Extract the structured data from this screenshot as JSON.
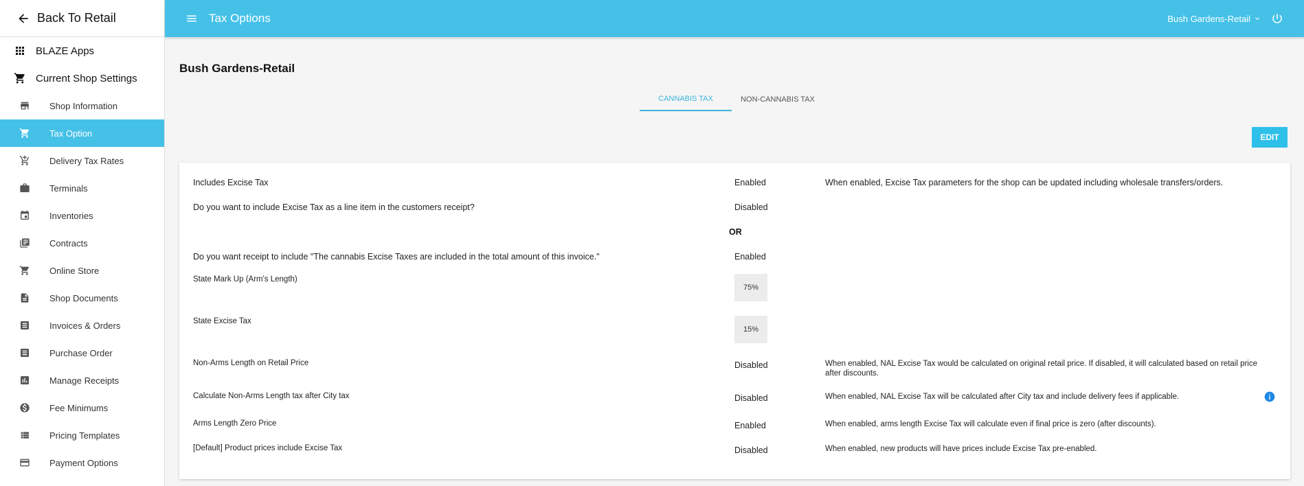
{
  "sidebar": {
    "back_label": "Back To Retail",
    "sections": [
      {
        "label": "BLAZE Apps",
        "icon": "apps-grid-icon"
      },
      {
        "label": "Current Shop Settings",
        "icon": "cart-icon"
      }
    ],
    "items": [
      {
        "label": "Shop Information",
        "icon": "store-icon",
        "active": false
      },
      {
        "label": "Tax Option",
        "icon": "cart-icon",
        "active": true
      },
      {
        "label": "Delivery Tax Rates",
        "icon": "cart-plus-icon",
        "active": false
      },
      {
        "label": "Terminals",
        "icon": "briefcase-icon",
        "active": false
      },
      {
        "label": "Inventories",
        "icon": "calendar-icon",
        "active": false
      },
      {
        "label": "Contracts",
        "icon": "library-icon",
        "active": false
      },
      {
        "label": "Online Store",
        "icon": "cart-icon",
        "active": false
      },
      {
        "label": "Shop Documents",
        "icon": "document-icon",
        "active": false
      },
      {
        "label": "Invoices & Orders",
        "icon": "list-icon",
        "active": false
      },
      {
        "label": "Purchase Order",
        "icon": "list-icon",
        "active": false
      },
      {
        "label": "Manage Receipts",
        "icon": "bar-chart-icon",
        "active": false
      },
      {
        "label": "Fee Minimums",
        "icon": "dollar-icon",
        "active": false
      },
      {
        "label": "Pricing Templates",
        "icon": "view-list-icon",
        "active": false
      },
      {
        "label": "Payment Options",
        "icon": "credit-card-icon",
        "active": false
      }
    ]
  },
  "header": {
    "title": "Tax Options",
    "shop_name": "Bush Gardens-Retail"
  },
  "main": {
    "shop_title": "Bush Gardens-Retail",
    "tabs": [
      {
        "label": "CANNABIS TAX",
        "active": true
      },
      {
        "label": "NON-CANNABIS TAX",
        "active": false
      }
    ],
    "edit_label": "EDIT",
    "or_label": "OR",
    "rows": {
      "excise": {
        "question": "Includes Excise Tax",
        "value": "Enabled",
        "desc": "When enabled, Excise Tax parameters for the shop can be updated including wholesale transfers/orders."
      },
      "line_item": {
        "question": "Do you want to include Excise Tax as a line item in the customers receipt?",
        "value": "Disabled"
      },
      "receipt_text": {
        "question": "Do you want receipt to include \"The cannabis Excise Taxes are included in the total amount of this invoice.\"",
        "value": "Enabled"
      },
      "markup": {
        "question": "State Mark Up (Arm's Length)",
        "value": "75%"
      },
      "state_excise": {
        "question": "State Excise Tax",
        "value": "15%"
      },
      "nal_retail": {
        "question": "Non-Arms Length on Retail Price",
        "value": "Disabled",
        "desc": "When enabled, NAL Excise Tax would be calculated on original retail price. If disabled, it will calculated based on retail price after discounts."
      },
      "nal_city": {
        "question": "Calculate Non-Arms Length tax after City tax",
        "value": "Disabled",
        "desc": "When enabled, NAL Excise Tax will be calculated after City tax and include delivery fees if applicable."
      },
      "zero_price": {
        "question": "Arms Length Zero Price",
        "value": "Enabled",
        "desc": "When enabled, arms length Excise Tax will calculate even if final price is zero (after discounts)."
      },
      "default_prices": {
        "question": "[Default] Product prices include Excise Tax",
        "value": "Disabled",
        "desc": "When enabled, new products will have prices include Excise Tax pre-enabled."
      }
    }
  }
}
